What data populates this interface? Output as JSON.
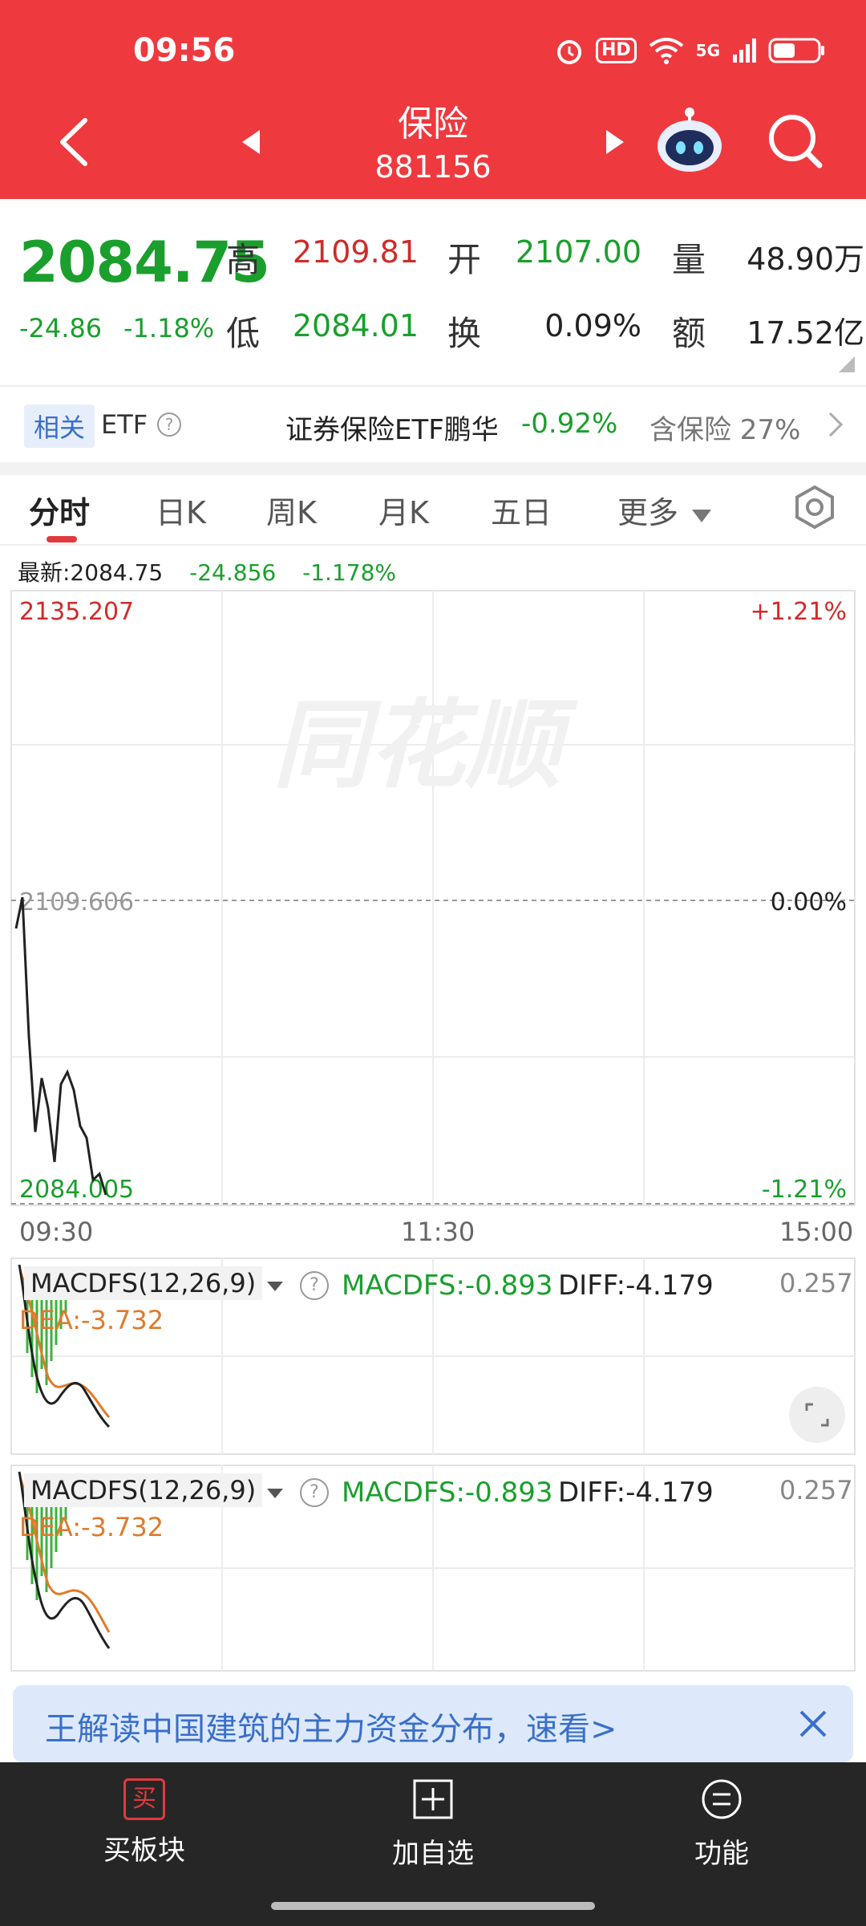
{
  "status": {
    "time": "09:56",
    "hd": "HD",
    "net": "5G"
  },
  "header": {
    "title": "保险",
    "code": "881156"
  },
  "quote": {
    "price": "2084.75",
    "change": "-24.86",
    "change_pct": "-1.18%",
    "high_label": "高",
    "high": "2109.81",
    "low_label": "低",
    "low": "2084.01",
    "open_label": "开",
    "open": "2107.00",
    "turnover_label": "换",
    "turnover": "0.09%",
    "volume_label": "量",
    "volume": "48.90万",
    "amount_label": "额",
    "amount": "17.52亿"
  },
  "etf": {
    "tag": "相关",
    "label": "ETF",
    "name": "证券保险ETF鹏华",
    "change": "-0.92%",
    "contain": "含保险 27%"
  },
  "tabs": [
    {
      "label": "分时",
      "active": true
    },
    {
      "label": "日K"
    },
    {
      "label": "周K"
    },
    {
      "label": "月K"
    },
    {
      "label": "五日"
    },
    {
      "label": "更多"
    }
  ],
  "chart": {
    "latest_label": "最新:2084.75",
    "latest_change": "-24.856",
    "latest_pct": "-1.178%",
    "y_top": "2135.207",
    "y_mid": "2109.606",
    "y_bottom": "2084.005",
    "pct_top": "+1.21%",
    "pct_mid": "0.00%",
    "pct_bottom": "-1.21%",
    "time_start": "09:30",
    "time_mid": "11:30",
    "time_end": "15:00",
    "watermark": "同花顺"
  },
  "chart_data": {
    "type": "line",
    "title": "",
    "series": [
      {
        "values": [
          2107.0,
          2109.6,
          2098.0,
          2090.0,
          2094.5,
          2092.0,
          2087.5,
          2094.0,
          2095.0,
          2093.5,
          2090.5,
          2089.5,
          2086.0,
          2086.5,
          2084.75
        ]
      }
    ],
    "ylim": [
      2084.005,
      2135.207
    ],
    "reference_line": 2109.606,
    "x_labels": [
      "09:30",
      "11:30",
      "15:00"
    ]
  },
  "macd": {
    "name": "MACDFS(12,26,9)",
    "value_label": "MACDFS:-0.893",
    "diff_label": "DIFF:-4.179",
    "dea_label": "DEA:-3.732",
    "right_value": "0.257"
  },
  "banner": {
    "text": "王解读中国建筑的主力资金分布，速看>"
  },
  "bottom": {
    "buy": "买板块",
    "buy_icon": "买",
    "add": "加自选",
    "func": "功能"
  },
  "colors": {
    "header_red": "#ee3a3f",
    "up_red": "#cf2b2b",
    "down_green": "#1a9f2d",
    "dea_orange": "#e07a2a"
  }
}
